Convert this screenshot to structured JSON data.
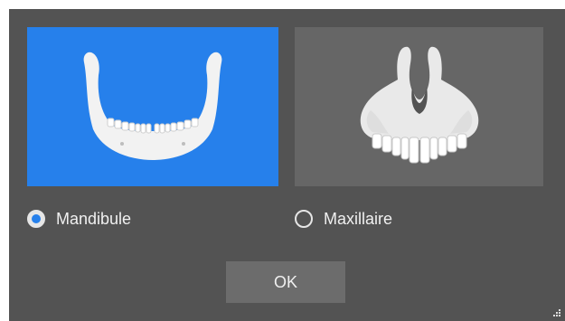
{
  "dialog": {
    "options": [
      {
        "label": "Mandibule",
        "icon": "mandible-icon",
        "selected": true
      },
      {
        "label": "Maxillaire",
        "icon": "maxilla-icon",
        "selected": false
      }
    ],
    "ok_label": "OK"
  },
  "colors": {
    "dialog_bg": "#535353",
    "selected_tile": "#2680eb",
    "unselected_tile": "#666666",
    "button_bg": "#6c6c6c",
    "bone": "#f2f2f2",
    "text": "#f0f0f0"
  }
}
